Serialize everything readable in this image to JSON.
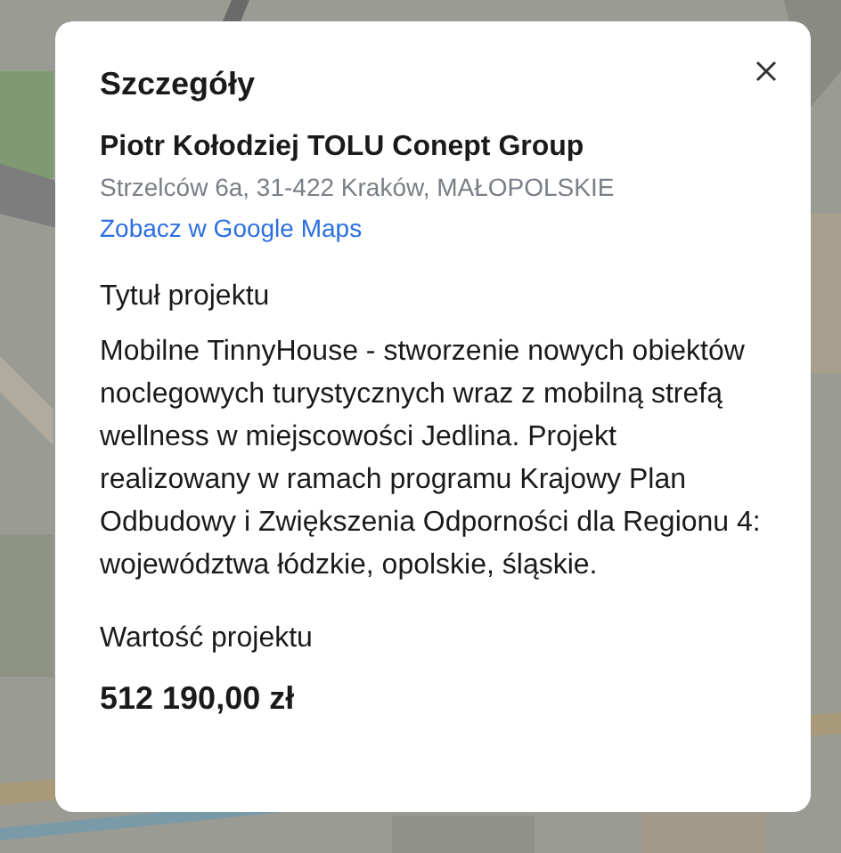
{
  "dialog": {
    "title": "Szczegóły",
    "company": "Piotr Kołodziej TOLU Conept Group",
    "address": "Strzelców 6a, 31-422 Kraków, MAŁOPOLSKIE",
    "map_link": "Zobacz w Google Maps",
    "sections": [
      {
        "kind": "text",
        "label": "Tytuł projektu",
        "value": "Mobilne TinnyHouse - stworzenie nowych obiektów noclegowych turystycznych wraz z mobilną strefą wellness w miejscowości Jedlina. Projekt realizowany w ramach programu Krajowy Plan Odbudowy i Zwiększenia Odporności dla Regionu 4: województwa łódzkie, opolskie, śląskie."
      },
      {
        "kind": "amount",
        "label": "Wartość projektu",
        "value": "512 190,00 zł"
      }
    ]
  }
}
